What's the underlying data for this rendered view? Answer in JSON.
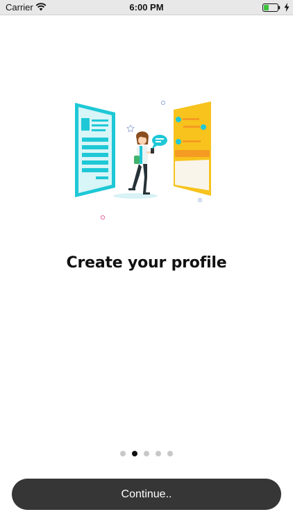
{
  "status_bar": {
    "carrier": "Carrier",
    "time": "6:00 PM",
    "icons": [
      "wifi-icon",
      "battery-icon",
      "charging-icon"
    ]
  },
  "onboarding": {
    "illustration": "profile-illustration",
    "title": "Create your profile",
    "page_count": 5,
    "active_page": 2
  },
  "continue_button": {
    "label": "Continue.."
  },
  "colors": {
    "cyan": "#1ec8d6",
    "yellow": "#f7c31c",
    "button_bg": "#363636",
    "dot_active": "#111111",
    "dot_inactive": "#c8c8c8"
  }
}
